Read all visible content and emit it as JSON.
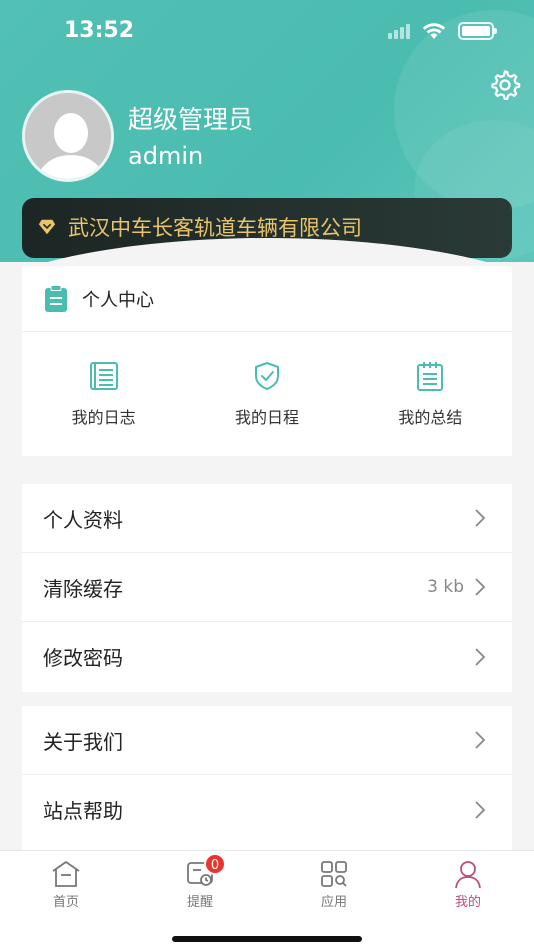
{
  "status_bar": {
    "time": "13:52"
  },
  "profile": {
    "name": "超级管理员",
    "account": "admin",
    "company": "武汉中车长客轨道车辆有限公司"
  },
  "personal_center": {
    "title": "个人中心",
    "items": [
      {
        "label": "我的日志",
        "icon": "log-icon"
      },
      {
        "label": "我的日程",
        "icon": "schedule-shield-icon"
      },
      {
        "label": "我的总结",
        "icon": "summary-icon"
      }
    ]
  },
  "settings_list": [
    {
      "label": "个人资料",
      "value": ""
    },
    {
      "label": "清除缓存",
      "value": "3 kb"
    },
    {
      "label": "修改密码",
      "value": ""
    }
  ],
  "about_list": [
    {
      "label": "关于我们"
    },
    {
      "label": "站点帮助"
    }
  ],
  "tabbar": {
    "tabs": [
      {
        "label": "首页"
      },
      {
        "label": "提醒",
        "badge": "0"
      },
      {
        "label": "应用"
      },
      {
        "label": "我的"
      }
    ],
    "active_index": 3
  },
  "colors": {
    "theme": "#4bbcb0",
    "accent_gold": "#e9c46a",
    "active_tab": "#c04b7b",
    "badge": "#e8352f"
  }
}
